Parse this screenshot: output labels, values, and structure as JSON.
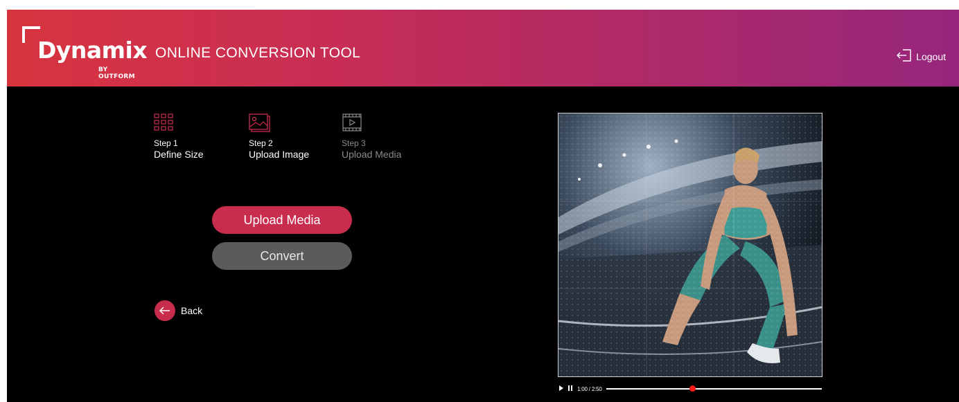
{
  "header": {
    "logo": {
      "brand": "Dynamix",
      "sub": "BY OUTFORM"
    },
    "title": "ONLINE CONVERSION TOOL",
    "logout_label": "Logout",
    "gradient_colors": [
      "#d8343f",
      "#96267c"
    ]
  },
  "steps": [
    {
      "number": "Step 1",
      "label": "Define Size",
      "icon": "grid-icon",
      "state": "done"
    },
    {
      "number": "Step 2",
      "label": "Upload Image",
      "icon": "image-icon",
      "state": "active"
    },
    {
      "number": "Step 3",
      "label": "Upload Media",
      "icon": "video-icon",
      "state": "disabled"
    }
  ],
  "actions": {
    "upload_label": "Upload Media",
    "convert_label": "Convert",
    "back_label": "Back"
  },
  "preview": {
    "description_icon": "image-preview",
    "player": {
      "time": "1:00 / 2:50",
      "progress": 0.4
    }
  },
  "colors": {
    "accent": "#c92d4d",
    "disabled_button": "#5b5b5b",
    "progress_knob": "#ff1a1a",
    "background": "#000000"
  }
}
